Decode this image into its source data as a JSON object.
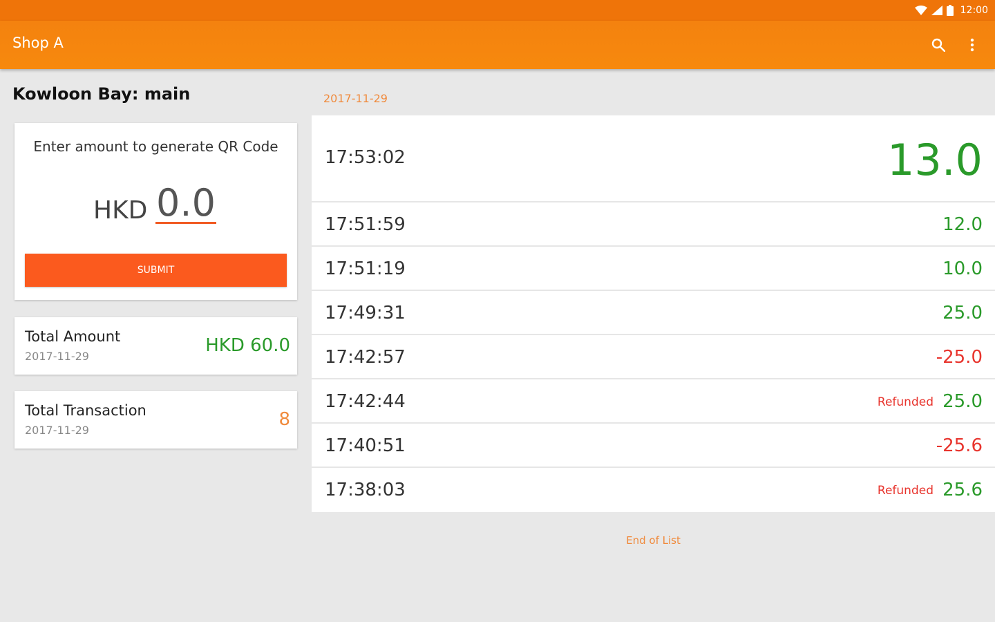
{
  "status_bar": {
    "time": "12:00",
    "icons": [
      "wifi-icon",
      "signal-icon",
      "battery-icon"
    ]
  },
  "app_bar": {
    "title": "Shop A",
    "actions": [
      "search-icon",
      "more-vert-icon"
    ],
    "color": "#f4820f"
  },
  "shop": {
    "heading": "Kowloon Bay: main"
  },
  "qr_card": {
    "prompt": "Enter amount to generate QR Code",
    "currency": "HKD",
    "amount_value": "0.0",
    "submit_label": "SUBMIT",
    "accent_color": "#fb5a1e"
  },
  "total_amount": {
    "label": "Total Amount",
    "date": "2017-11-29",
    "value": "HKD 60.0"
  },
  "total_transaction": {
    "label": "Total Transaction",
    "date": "2017-11-29",
    "value": "8"
  },
  "list": {
    "date": "2017-11-29",
    "transactions": [
      {
        "time": "17:53:02",
        "amount": "13.0",
        "status": ""
      },
      {
        "time": "17:51:59",
        "amount": "12.0",
        "status": ""
      },
      {
        "time": "17:51:19",
        "amount": "10.0",
        "status": ""
      },
      {
        "time": "17:49:31",
        "amount": "25.0",
        "status": ""
      },
      {
        "time": "17:42:57",
        "amount": "-25.0",
        "status": ""
      },
      {
        "time": "17:42:44",
        "amount": "25.0",
        "status": "Refunded"
      },
      {
        "time": "17:40:51",
        "amount": "-25.6",
        "status": ""
      },
      {
        "time": "17:38:03",
        "amount": "25.6",
        "status": "Refunded"
      }
    ],
    "end_text": "End of List"
  },
  "colors": {
    "positive": "#2a9a2a",
    "negative": "#e8342d",
    "highlight": "#f08a3c"
  }
}
